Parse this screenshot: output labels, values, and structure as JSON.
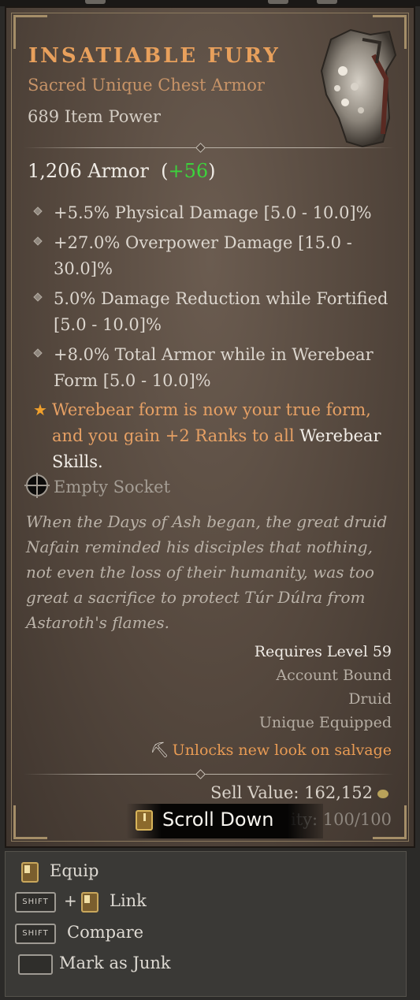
{
  "item": {
    "name": "INSATIABLE FURY",
    "type_line": "Sacred Unique Chest Armor",
    "item_power": "689 Item Power",
    "armor_value": "1,206 Armor",
    "armor_bonus": "+56",
    "affixes": [
      "+5.5% Physical Damage [5.0 - 10.0]%",
      "+27.0% Overpower Damage [15.0 - 30.0]%",
      "5.0% Damage Reduction while Fortified [5.0 - 10.0]%",
      "+8.0% Total Armor while in Werebear Form [5.0 - 10.0]%"
    ],
    "unique_power_main": "Werebear form is now your true form, and you gain +2 Ranks to all ",
    "unique_power_highlight": "Werebear Skills.",
    "socket": "Empty Socket",
    "flavor_text": "When the Days of Ash began, the great druid Nafain reminded his disciples that nothing, not even the loss of their humanity, was too great a sacrifice to protect Túr Dúlra from Astaroth's flames.",
    "requirements": {
      "level": "Requires Level 59",
      "bound": "Account Bound",
      "class": "Druid",
      "equip_rule": "Unique Equipped"
    },
    "salvage_note": "Unlocks new look on salvage",
    "sell_value": "Sell Value: 162,152",
    "durability": "ity: 100/100"
  },
  "scroll_hint": "Scroll Down",
  "actions": {
    "equip": "Equip",
    "link": "Link",
    "compare": "Compare",
    "junk": "Mark as Junk",
    "shift_key": "SHIFT",
    "plus": "+"
  },
  "icons": {
    "armor": "chest-armor-icon",
    "socket": "socket-icon",
    "salvage": "pickaxe-icon",
    "gold": "gold-coin-icon",
    "mouse": "mouse-button-icon",
    "shift": "shift-key-icon",
    "space": "spacebar-key-icon"
  },
  "colors": {
    "title": "#e8a05c",
    "bonus": "#3cd43c",
    "unique": "#e6a064",
    "panel": "#54473d"
  }
}
